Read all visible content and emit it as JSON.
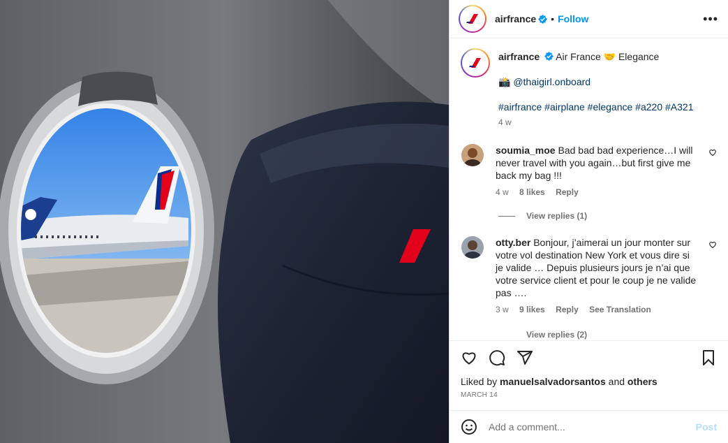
{
  "header": {
    "username": "airfrance",
    "follow_label": "Follow",
    "separator": "•"
  },
  "caption": {
    "username": "airfrance",
    "text": "Air France 🤝 Elegance",
    "credit_emoji": "📸",
    "credit_handle": "@thaigirl.onboard",
    "hashtags": [
      "#airfrance",
      "#airplane",
      "#elegance",
      "#a220",
      "#A321"
    ],
    "age": "4 w"
  },
  "comments": [
    {
      "username": "soumia_moe",
      "text": "Bad bad bad experience…I will never travel with you again…but first give me back my bag !!!",
      "age": "4 w",
      "likes": "8 likes",
      "reply_label": "Reply",
      "view_replies": "View replies (1)"
    },
    {
      "username": "otty.ber",
      "text": "Bonjour, j’aimerai un jour monter sur votre vol destination New York et vous dire si je valide … Depuis plusieurs jours je n’ai que votre service client et pour le coup je ne valide pas ….",
      "age": "3 w",
      "likes": "9 likes",
      "reply_label": "Reply",
      "translation_label": "See Translation",
      "view_replies": "View replies (2)"
    }
  ],
  "likes": {
    "prefix": "Liked by",
    "user": "manuelsalvadorsantos",
    "and": "and",
    "others": "others",
    "date": "MARCH 14"
  },
  "add_comment": {
    "placeholder": "Add a comment...",
    "post_label": "Post"
  },
  "icons": {
    "verified": "verified-badge-icon",
    "more": "more-options-icon",
    "like": "heart-icon",
    "comment": "comment-icon",
    "share": "share-icon",
    "save": "bookmark-icon",
    "emoji": "emoji-icon"
  },
  "colors": {
    "accent": "#0095f6",
    "link": "#00376b",
    "muted": "#737373",
    "post_disabled": "#b2dffc",
    "brand_red": "#e3001b"
  }
}
